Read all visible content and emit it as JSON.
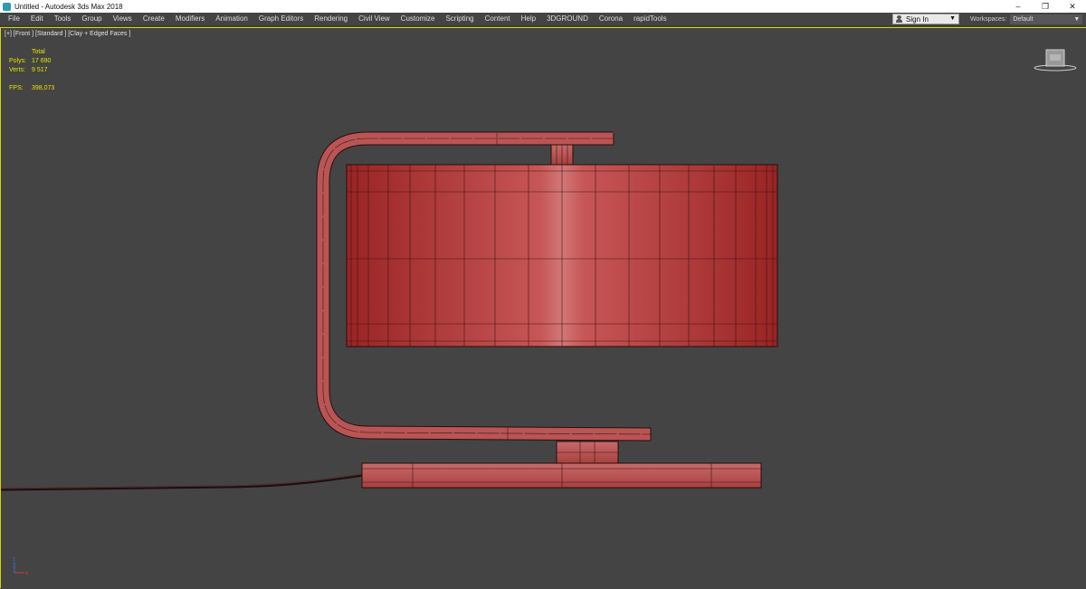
{
  "window": {
    "title": "Untitled - Autodesk 3ds Max 2018",
    "controls": [
      "–",
      "❐",
      "✕"
    ]
  },
  "menu": {
    "items": [
      "File",
      "Edit",
      "Tools",
      "Group",
      "Views",
      "Create",
      "Modifiers",
      "Animation",
      "Graph Editors",
      "Rendering",
      "Civil View",
      "Customize",
      "Scripting",
      "Content",
      "Help",
      "3DGROUND",
      "Corona",
      "rapidTools"
    ],
    "sign_in": "Sign In",
    "workspaces_label": "Workspaces:",
    "workspaces_value": "Default"
  },
  "viewport": {
    "label": "[+] [Front ] [Standard ] [Clay + Edged Faces ]",
    "stats": {
      "header": "Total",
      "polys_label": "Polys:",
      "polys_value": "17 690",
      "verts_label": "Verts:",
      "verts_value": "9 517",
      "fps_label": "FPS:",
      "fps_value": "398,073"
    }
  },
  "colors": {
    "viewport_bg": "#444444",
    "active_border": "#d6d600",
    "mesh_fill": "#b84848",
    "stats_text": "#e3e300"
  },
  "icons": {
    "app": "3dsmax-icon",
    "user": "user-icon",
    "viewcube": "viewcube-icon",
    "axis": "axis-gizmo-icon"
  }
}
